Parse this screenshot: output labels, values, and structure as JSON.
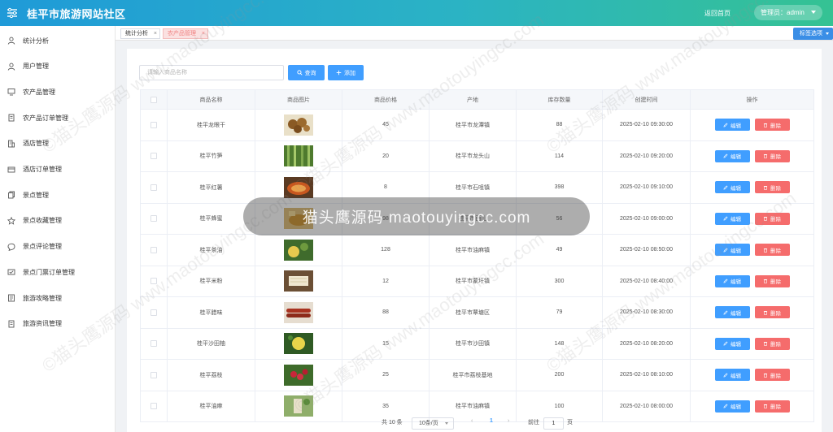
{
  "header": {
    "site_title": "桂平市旅游网站社区",
    "home_link": "返回首页",
    "admin_label": "管理员：admin"
  },
  "sidebar": {
    "items": [
      {
        "label": "统计分析",
        "icon": "user-icon"
      },
      {
        "label": "用户管理",
        "icon": "user-icon"
      },
      {
        "label": "农产品管理",
        "icon": "monitor-icon"
      },
      {
        "label": "农产品订单管理",
        "icon": "document-icon"
      },
      {
        "label": "酒店管理",
        "icon": "building-icon"
      },
      {
        "label": "酒店订单管理",
        "icon": "card-icon"
      },
      {
        "label": "景点管理",
        "icon": "copy-icon"
      },
      {
        "label": "景点收藏管理",
        "icon": "star-icon"
      },
      {
        "label": "景点评论管理",
        "icon": "comment-icon"
      },
      {
        "label": "景点门票订单管理",
        "icon": "ticket-icon"
      },
      {
        "label": "旅游攻略管理",
        "icon": "list-icon"
      },
      {
        "label": "旅游资讯管理",
        "icon": "document-icon"
      }
    ]
  },
  "tabs": [
    {
      "label": "统计分析",
      "active": false
    },
    {
      "label": "农产品管理",
      "active": true
    }
  ],
  "tab_options_label": "标签选项",
  "toolbar": {
    "search_placeholder": "请输入商品名称",
    "search_button": "查询",
    "add_button": "添加"
  },
  "table": {
    "columns": [
      "",
      "商品名称",
      "商品图片",
      "商品价格",
      "产地",
      "库存数量",
      "创建时间",
      "操作"
    ],
    "edit_label": "编辑",
    "delete_label": "删除",
    "rows": [
      {
        "name": "桂平龙眼干",
        "price": "45",
        "origin": "桂平市龙潭镇",
        "stock": "88",
        "created": "2025-02-10 09:30:00",
        "img": "longan"
      },
      {
        "name": "桂平竹笋",
        "price": "20",
        "origin": "桂平市龙头山",
        "stock": "114",
        "created": "2025-02-10 09:20:00",
        "img": "bamboo"
      },
      {
        "name": "桂平红薯",
        "price": "8",
        "origin": "桂平市石咀镇",
        "stock": "398",
        "created": "2025-02-10 09:10:00",
        "img": "sweetpotato"
      },
      {
        "name": "桂平蜂蜜",
        "price": "98",
        "origin": "桂平市西山",
        "stock": "56",
        "created": "2025-02-10 09:00:00",
        "img": "honey"
      },
      {
        "name": "桂平茶油",
        "price": "128",
        "origin": "桂平市油麻镇",
        "stock": "49",
        "created": "2025-02-10 08:50:00",
        "img": "teaoil"
      },
      {
        "name": "桂平米粉",
        "price": "12",
        "origin": "桂平市蒙圩镇",
        "stock": "300",
        "created": "2025-02-10 08:40:00",
        "img": "ricenoodle"
      },
      {
        "name": "桂平腊味",
        "price": "88",
        "origin": "桂平市覃塘区",
        "stock": "79",
        "created": "2025-02-10 08:30:00",
        "img": "sausage"
      },
      {
        "name": "桂平沙田柚",
        "price": "15",
        "origin": "桂平市沙田镇",
        "stock": "148",
        "created": "2025-02-10 08:20:00",
        "img": "pomelo"
      },
      {
        "name": "桂平荔枝",
        "price": "25",
        "origin": "桂平市荔枝基地",
        "stock": "200",
        "created": "2025-02-10 08:10:00",
        "img": "lychee"
      },
      {
        "name": "桂平油麻",
        "price": "35",
        "origin": "桂平市油麻镇",
        "stock": "100",
        "created": "2025-02-10 08:00:00",
        "img": "sesame"
      }
    ]
  },
  "pagination": {
    "total_label": "共 10 条",
    "page_size": "10条/页",
    "current_page": "1",
    "goto_label": "前往",
    "goto_value": "1",
    "page_suffix": "页"
  },
  "watermark": {
    "center_text": "猫头鹰源码 maotouyingcc.com",
    "tile_text": "©猫头鹰源码 www.maotouyingcc.com"
  }
}
